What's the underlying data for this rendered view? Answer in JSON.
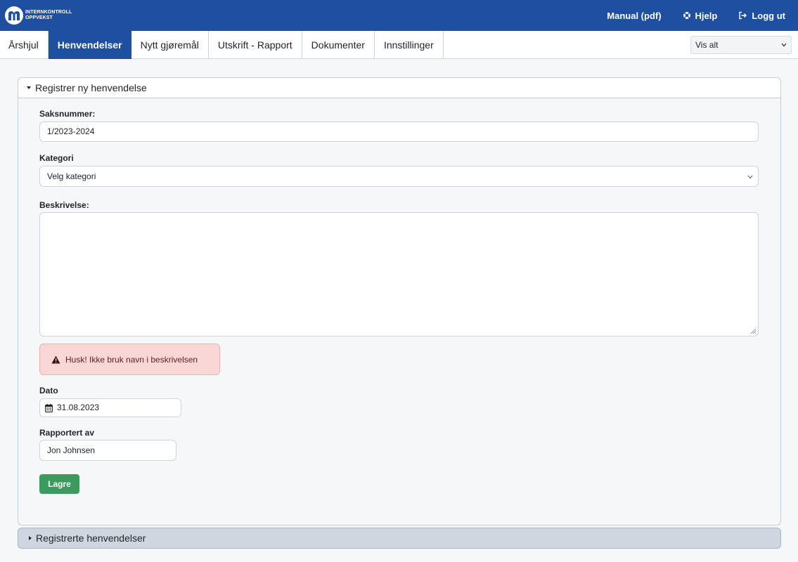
{
  "header": {
    "logo_line1": "INTERNKONTROLL",
    "logo_line2": "OPPVEKST",
    "links": {
      "manual": "Manual (pdf)",
      "help": "Hjelp",
      "logout": "Logg ut"
    },
    "brand_color": "#1e4fa0"
  },
  "tabs": [
    {
      "label": "Årshjul"
    },
    {
      "label": "Henvendelser",
      "active": true
    },
    {
      "label": "Nytt gjøremål"
    },
    {
      "label": "Utskrift - Rapport"
    },
    {
      "label": "Dokumenter"
    },
    {
      "label": "Innstillinger"
    }
  ],
  "view_filter": {
    "selected": "Vis alt"
  },
  "register_panel": {
    "title": "Registrer ny henvendelse",
    "case_number": {
      "label": "Saksnummer:",
      "value": "1/2023-2024"
    },
    "category": {
      "label": "Kategori",
      "selected": "Velg kategori"
    },
    "description": {
      "label": "Beskrivelse:",
      "value": ""
    },
    "warning": "Husk! Ikke bruk navn i beskrivelsen",
    "date": {
      "label": "Dato",
      "value": "31.08.2023"
    },
    "reported_by": {
      "label": "Rapportert av",
      "value": "Jon Johnsen"
    },
    "save_label": "Lagre",
    "save_color": "#3a9b5c"
  },
  "registered_panel": {
    "title": "Registrerte henvendelser"
  }
}
